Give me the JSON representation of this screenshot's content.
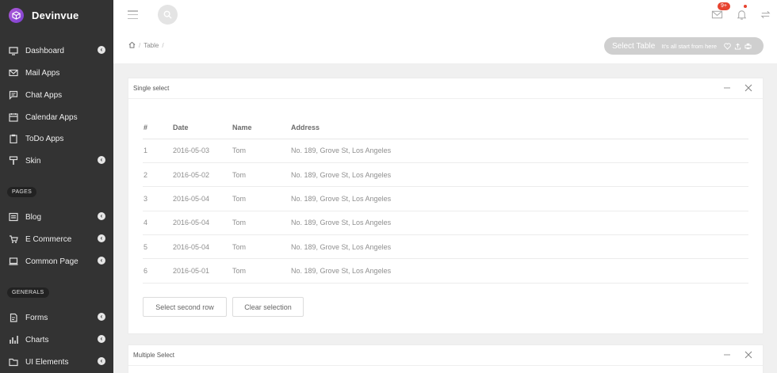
{
  "brand": {
    "name": "Devinvue"
  },
  "sidebar": {
    "items": [
      {
        "label": "Dashboard",
        "icon": "monitor-icon",
        "has_chevron": true
      },
      {
        "label": "Mail Apps",
        "icon": "mail-icon",
        "has_chevron": false
      },
      {
        "label": "Chat Apps",
        "icon": "chat-icon",
        "has_chevron": false
      },
      {
        "label": "Calendar Apps",
        "icon": "calendar-icon",
        "has_chevron": false
      },
      {
        "label": "ToDo Apps",
        "icon": "clipboard-icon",
        "has_chevron": false
      },
      {
        "label": "Skin",
        "icon": "paint-roller-icon",
        "has_chevron": true
      }
    ],
    "section_pages": "PAGES",
    "pages_items": [
      {
        "label": "Blog",
        "icon": "list-icon",
        "has_chevron": true
      },
      {
        "label": "E Commerce",
        "icon": "cart-icon",
        "has_chevron": true
      },
      {
        "label": "Common Page",
        "icon": "laptop-icon",
        "has_chevron": true
      }
    ],
    "section_generals": "GENERALS",
    "generals_items": [
      {
        "label": "Forms",
        "icon": "form-icon",
        "has_chevron": true
      },
      {
        "label": "Charts",
        "icon": "bar-chart-icon",
        "has_chevron": true
      },
      {
        "label": "UI Elements",
        "icon": "folder-icon",
        "has_chevron": true
      }
    ]
  },
  "header": {
    "notification_badge": "9+"
  },
  "breadcrumb": {
    "current": "Table"
  },
  "page_pill": {
    "title": "Select Table",
    "subtitle": "It's all start from here"
  },
  "card_single": {
    "title": "Single select",
    "columns": [
      "#",
      "Date",
      "Name",
      "Address"
    ],
    "rows": [
      [
        "1",
        "2016-05-03",
        "Tom",
        "No. 189, Grove St, Los Angeles"
      ],
      [
        "2",
        "2016-05-02",
        "Tom",
        "No. 189, Grove St, Los Angeles"
      ],
      [
        "3",
        "2016-05-04",
        "Tom",
        "No. 189, Grove St, Los Angeles"
      ],
      [
        "4",
        "2016-05-04",
        "Tom",
        "No. 189, Grove St, Los Angeles"
      ],
      [
        "5",
        "2016-05-04",
        "Tom",
        "No. 189, Grove St, Los Angeles"
      ],
      [
        "6",
        "2016-05-01",
        "Tom",
        "No. 189, Grove St, Los Angeles"
      ]
    ],
    "select_second_label": "Select second row",
    "clear_label": "Clear selection"
  },
  "card_multiple": {
    "title": "Multiple Select"
  },
  "colors": {
    "sidebar_bg": "#333333",
    "badge": "#e7432f",
    "brand_logo": "#9b4fd6"
  }
}
